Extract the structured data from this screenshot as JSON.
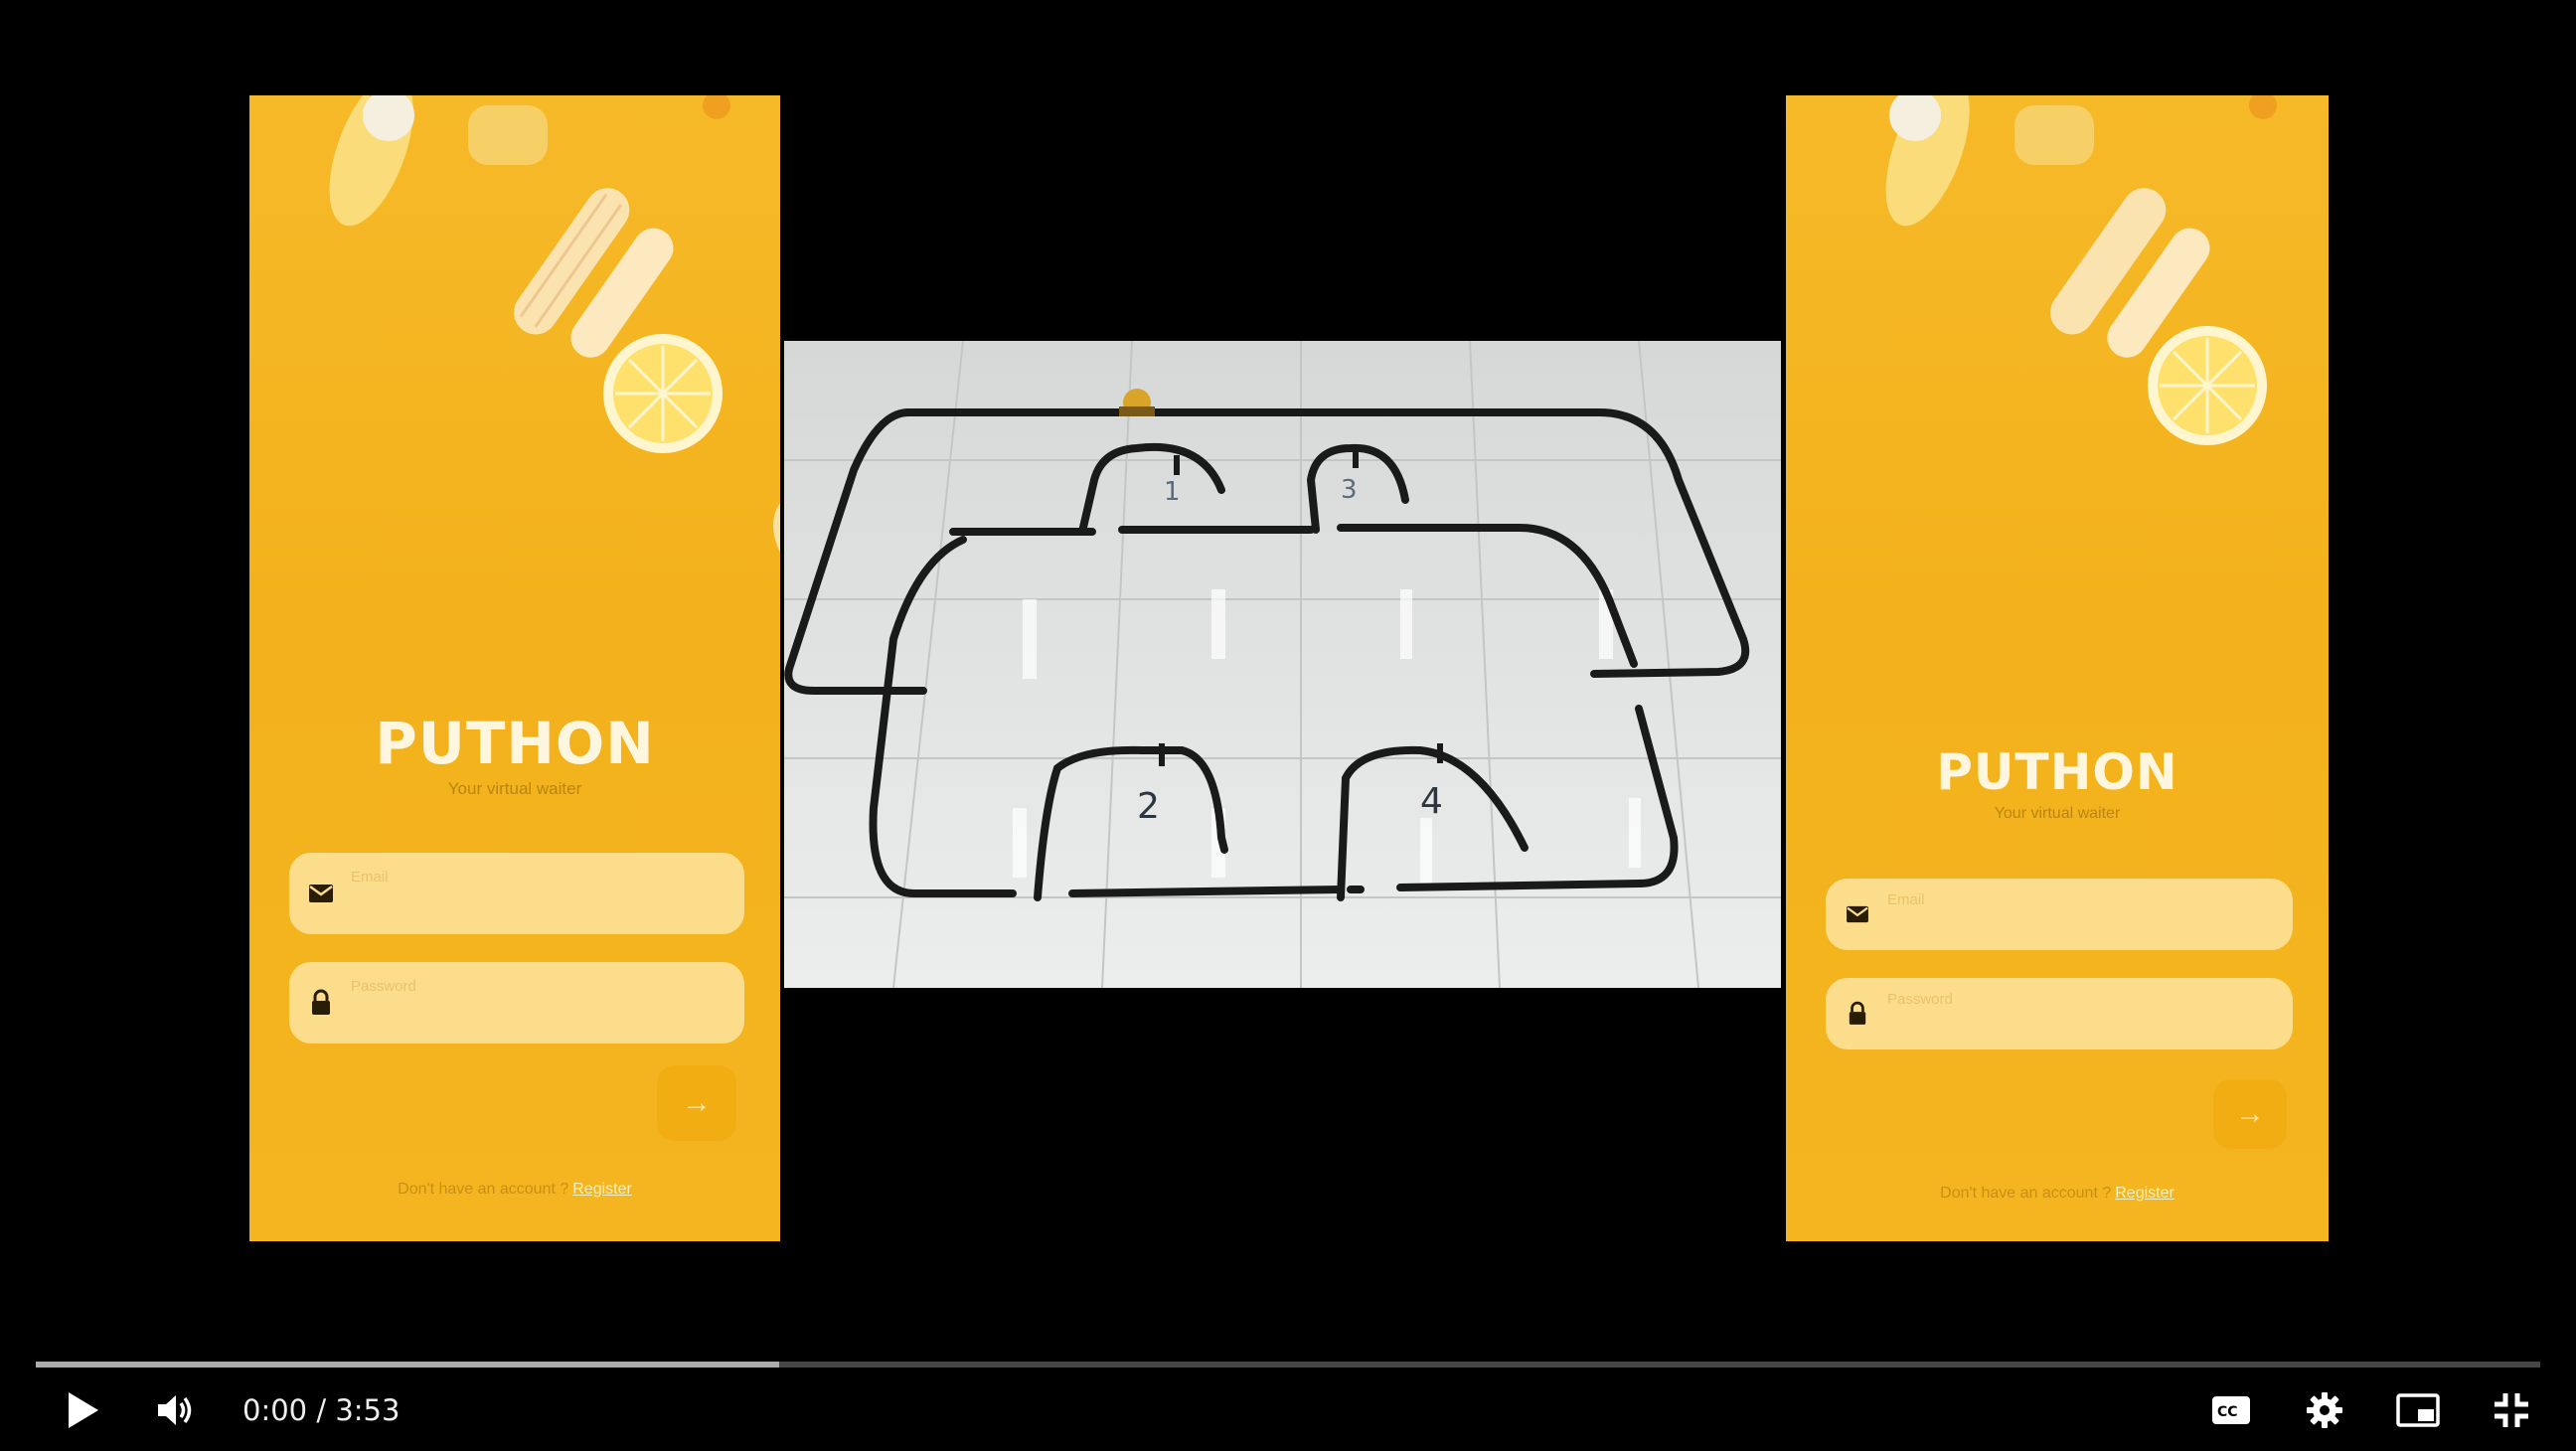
{
  "left_phone": {
    "brand": "PUTHON",
    "tagline": "Your virtual waiter",
    "email_placeholder": "Email",
    "password_placeholder": "Password",
    "footer_text": "Don't have an account ?",
    "footer_link": "Register"
  },
  "right_phone": {
    "brand": "PUTHON",
    "tagline": "Your virtual waiter",
    "email_placeholder": "Email",
    "password_placeholder": "Password",
    "footer_text": "Don't have an account ?",
    "footer_link": "Register"
  },
  "track": {
    "table_labels": [
      "1",
      "3",
      "2",
      "4"
    ]
  },
  "player": {
    "current_time": "0:00",
    "duration": "3:53",
    "time_display": "0:00 / 3:53",
    "buffered_fraction": 0.297,
    "icons": {
      "play": "play-icon",
      "volume": "volume-icon",
      "captions": "cc-icon",
      "settings": "gear-icon",
      "miniplayer": "miniplayer-icon",
      "exit_fullscreen": "exit-fullscreen-icon"
    }
  },
  "colors": {
    "brand_yellow": "#f4b520",
    "field_fill": "#fbdd8c",
    "background": "#000000"
  }
}
